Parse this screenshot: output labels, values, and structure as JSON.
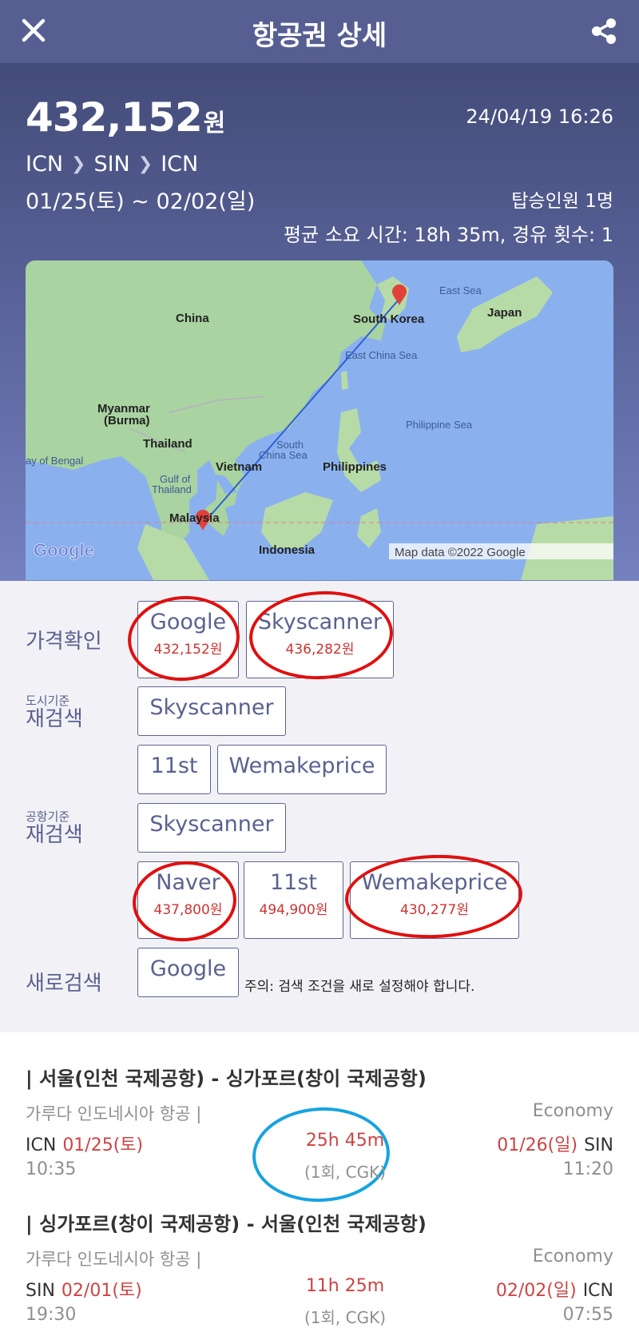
{
  "header": {
    "title": "항공권 상세",
    "close_icon": "close-icon",
    "share_icon": "share-icon"
  },
  "summary": {
    "price": "432,152",
    "price_unit": "원",
    "timestamp": "24/04/19 16:26",
    "route": [
      "ICN",
      "SIN",
      "ICN"
    ],
    "dates": "01/25(토) ~ 02/02(일)",
    "passengers": "탑승인원 1명",
    "avg_info": "평균 소요 시간: 18h 35m, 경유 횟수: 1"
  },
  "map": {
    "labels": {
      "china": "China",
      "south_korea": "South Korea",
      "japan": "Japan",
      "east_sea": "East Sea",
      "east_china_sea": "East China Sea",
      "myanmar": "Myanmar",
      "burma": "(Burma)",
      "thailand": "Thailand",
      "bay_of_bengal": "ay of Bengal",
      "vietnam": "Vietnam",
      "south": "South",
      "china_sea": "China Sea",
      "philippines": "Philippines",
      "philippine_sea": "Philippine Sea",
      "gulf_of": "Gulf of",
      "thailand2": "Thailand",
      "malaysia": "Malaysia",
      "indonesia": "Indonesia",
      "google": "Google",
      "credit": "Map data ©2022 Google"
    }
  },
  "price_check": {
    "label": "가격확인",
    "buttons": [
      {
        "name": "Google",
        "price": "432,152원"
      },
      {
        "name": "Skyscanner",
        "price": "436,282원"
      }
    ]
  },
  "city_research": {
    "small": "도시기준",
    "main": "재검색",
    "buttons": [
      "Skyscanner",
      "11st",
      "Wemakeprice"
    ]
  },
  "airport_research": {
    "small": "공항기준",
    "main": "재검색",
    "buttons": [
      {
        "name": "Skyscanner",
        "price": ""
      },
      {
        "name": "Naver",
        "price": "437,800원"
      },
      {
        "name": "11st",
        "price": "494,900원"
      },
      {
        "name": "Wemakeprice",
        "price": "430,277원"
      }
    ]
  },
  "new_search": {
    "label": "새로검색",
    "button": "Google",
    "note": "주의: 검색 조건을 새로 설정해야 합니다."
  },
  "itineraries": [
    {
      "head": "| 서울(인천 국제공항) -  싱가포르(창이 국제공항)",
      "airline": "가루다 인도네시아 항공 |",
      "class": "Economy",
      "dep_code": "ICN",
      "dep_date": "01/25(토)",
      "dep_time": "10:35",
      "duration": "25h 45m",
      "stops": "(1회, CGK)",
      "arr_date": "01/26(일)",
      "arr_code": "SIN",
      "arr_time": "11:20"
    },
    {
      "head": "| 싱가포르(창이 국제공항) -  서울(인천 국제공항)",
      "airline": "가루다 인도네시아 항공 |",
      "class": "Economy",
      "dep_code": "SIN",
      "dep_date": "02/01(토)",
      "dep_time": "19:30",
      "duration": "11h 25m",
      "stops": "(1회, CGK)",
      "arr_date": "02/02(일)",
      "arr_code": "ICN",
      "arr_time": "07:55"
    }
  ]
}
